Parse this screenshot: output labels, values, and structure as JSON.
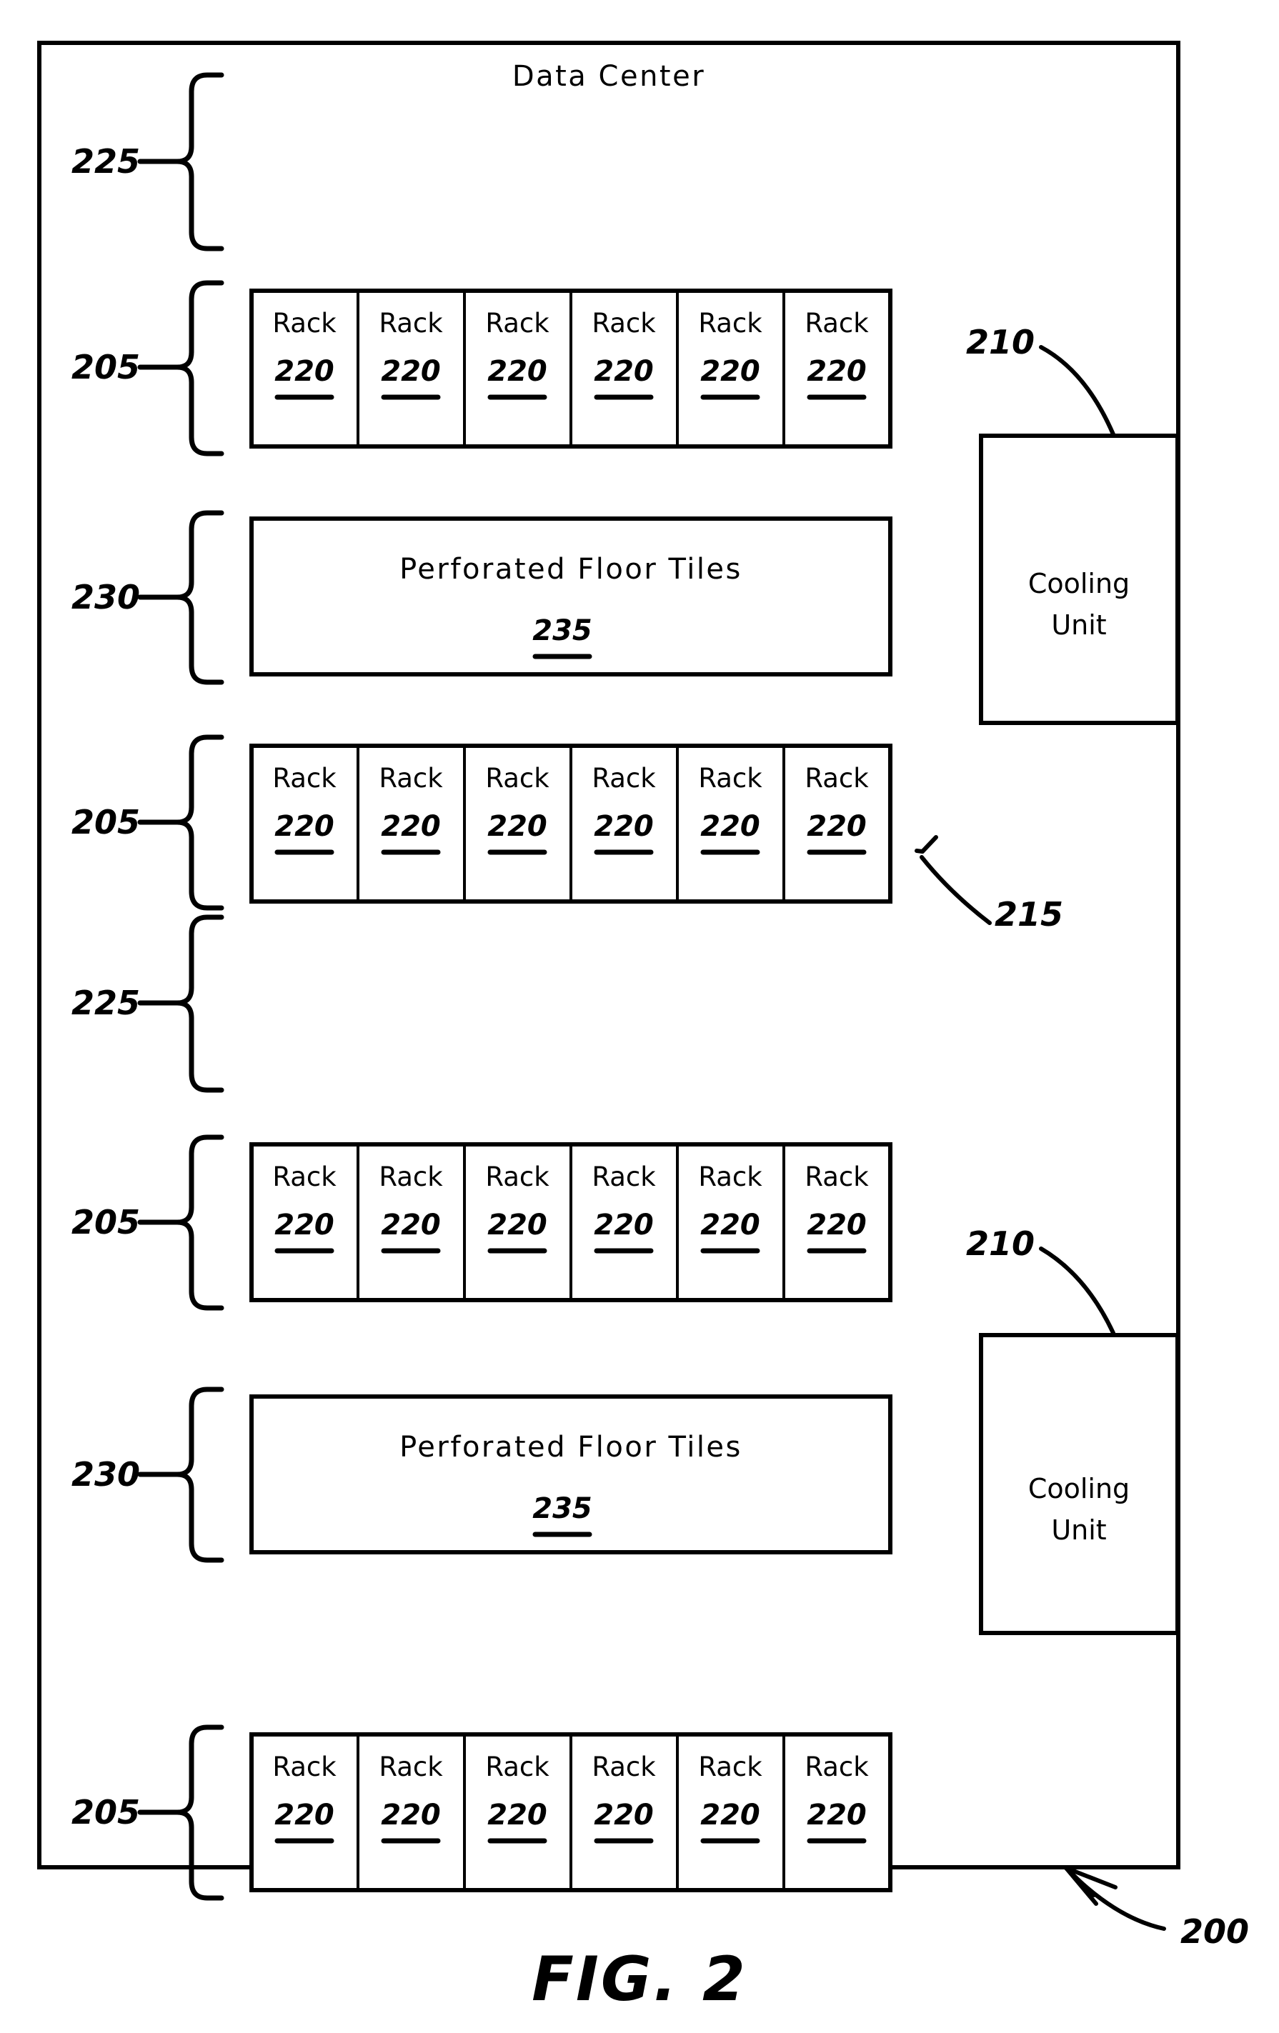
{
  "figure": {
    "caption": "FIG.  2",
    "title": "Data Center",
    "overall_ref": "200"
  },
  "labels": {
    "hot_aisle_ref": "225",
    "rack_row_ref": "205",
    "cold_aisle_ref": "230",
    "cooling_unit_ref": "210",
    "rack_row_arrow_ref": "215"
  },
  "rack": {
    "name": "Rack",
    "ref": "220"
  },
  "floor_tiles": {
    "name": "Perforated Floor Tiles",
    "ref": "235"
  },
  "cooling_unit": {
    "line1": "Cooling",
    "line2": "Unit"
  },
  "rows": [
    {
      "kind": "aisle",
      "ref": "225"
    },
    {
      "kind": "racks",
      "ref": "205",
      "count": 6
    },
    {
      "kind": "tiles",
      "ref": "230"
    },
    {
      "kind": "racks",
      "ref": "205",
      "count": 6
    },
    {
      "kind": "aisle",
      "ref": "225"
    },
    {
      "kind": "racks",
      "ref": "205",
      "count": 6
    },
    {
      "kind": "tiles",
      "ref": "230"
    },
    {
      "kind": "racks",
      "ref": "205",
      "count": 6
    }
  ],
  "cooling_units": [
    {
      "ref": "210"
    },
    {
      "ref": "210"
    }
  ],
  "colors": {
    "line": "#000000",
    "background": "#ffffff",
    "fill": "#ffffff"
  }
}
